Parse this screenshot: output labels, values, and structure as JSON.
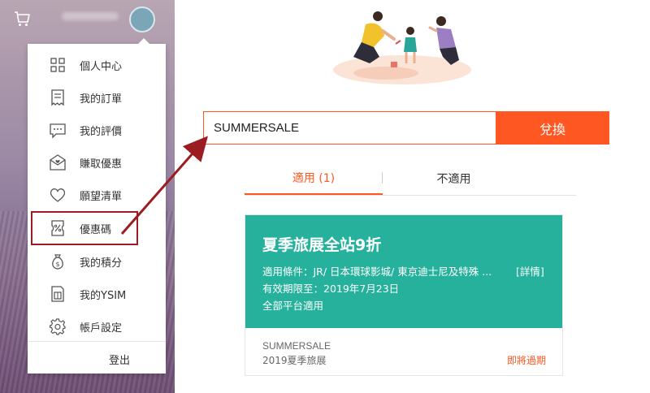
{
  "colors": {
    "accent": "#ff5722",
    "coupon_bg": "#25b19b",
    "annotation": "#9b1d22"
  },
  "header": {
    "cart_icon": "cart-icon",
    "avatar_icon": "avatar"
  },
  "menu": {
    "items": [
      {
        "label": "個人中心",
        "icon": "grid-icon"
      },
      {
        "label": "我的訂單",
        "icon": "receipt-icon"
      },
      {
        "label": "我的評價",
        "icon": "chat-bubble-icon"
      },
      {
        "label": "賺取優惠",
        "icon": "envelope-icon"
      },
      {
        "label": "願望清單",
        "icon": "heart-icon"
      },
      {
        "label": "優惠碼",
        "icon": "coupon-icon"
      },
      {
        "label": "我的積分",
        "icon": "money-bag-icon"
      },
      {
        "label": "我的YSIM",
        "icon": "sim-card-icon"
      },
      {
        "label": "帳戶設定",
        "icon": "gear-icon"
      }
    ],
    "logout_label": "登出"
  },
  "redeem": {
    "input_value": "SUMMERSALE",
    "button_label": "兌換"
  },
  "tabs": [
    {
      "label": "適用 (1)"
    },
    {
      "label": "不適用"
    }
  ],
  "coupon": {
    "title": "夏季旅展全站9折",
    "conditions": "適用條件：JR/ 日本環球影城/ 東京迪士尼及特殊 ...",
    "detail_link": "[詳情]",
    "validity": "有效期限至：2019年7月23日",
    "platforms": "全部平台適用",
    "code": "SUMMERSALE",
    "event": "2019夏季旅展",
    "expiry_status": "即將過期"
  }
}
